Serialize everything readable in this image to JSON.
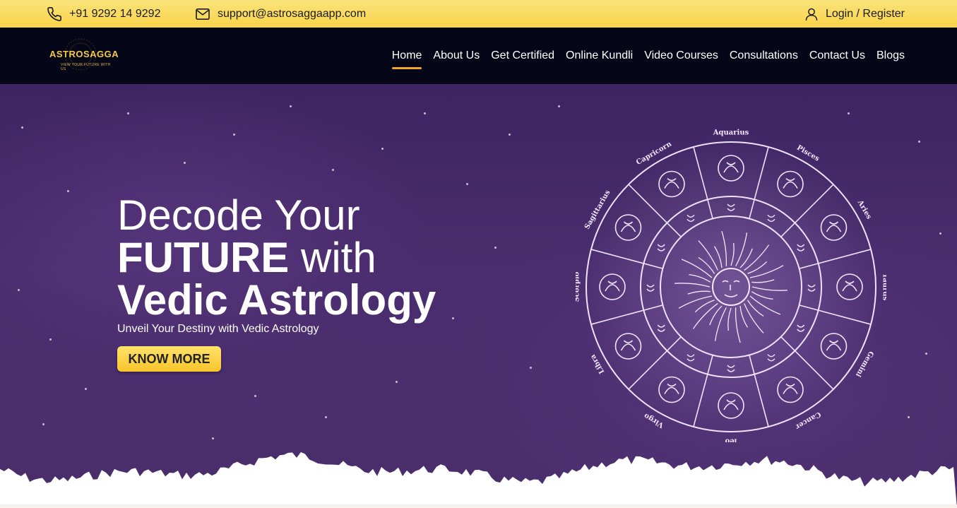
{
  "topbar": {
    "phone": "+91 9292 14 9292",
    "email": "support@astrosaggaapp.com",
    "login": "Login / Register",
    "icons": {
      "phone": "phone-icon",
      "email": "mail-icon",
      "login": "user-icon"
    }
  },
  "brand": {
    "name": "ASTROSAGGA",
    "tagline": "VIEW YOUR FUTURE WITH US",
    "colors": {
      "gold": "#f5c84a",
      "accent": "#f5a623",
      "nav_bg": "#050718",
      "topbar": "#fbd54a",
      "hero": "#4a2d6e"
    }
  },
  "nav": {
    "items": [
      {
        "label": "Home",
        "active": true
      },
      {
        "label": "About Us"
      },
      {
        "label": "Get Certified"
      },
      {
        "label": "Online Kundli"
      },
      {
        "label": "Video Courses"
      },
      {
        "label": "Consultations"
      },
      {
        "label": "Contact Us"
      },
      {
        "label": "Blogs"
      }
    ]
  },
  "hero": {
    "title_line1": "Decode Your",
    "title_line2_bold": "FUTURE",
    "title_line2_rest": " with",
    "title_line3": "Vedic Astrology",
    "subtitle": "Unveil Your Destiny with Vedic Astrology",
    "cta": "KNOW MORE"
  },
  "zodiac_wheel": {
    "signs": [
      "Aquarius",
      "Pisces",
      "Aries",
      "Taurus",
      "Gemini",
      "Cancer",
      "leo",
      "Virgo",
      "Libra",
      "Scorpio",
      "Sagittarius",
      "Capricorn"
    ]
  }
}
